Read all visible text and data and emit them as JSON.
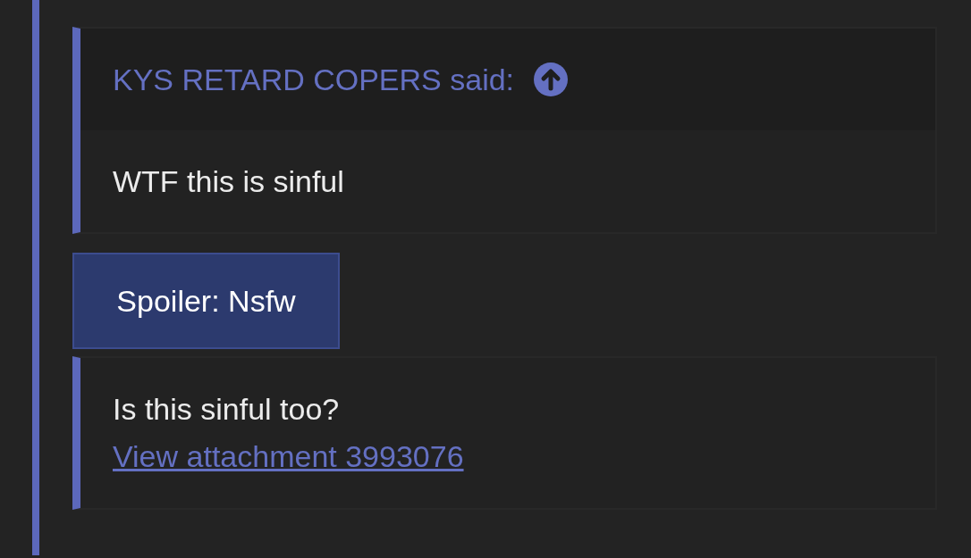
{
  "quote": {
    "author_line": "KYS RETARD COPERS said:",
    "body": "WTF this is sinful"
  },
  "spoiler": {
    "label": "Spoiler: Nsfw"
  },
  "reply_box": {
    "text": "Is this sinful too?",
    "link": "View attachment 3993076"
  }
}
